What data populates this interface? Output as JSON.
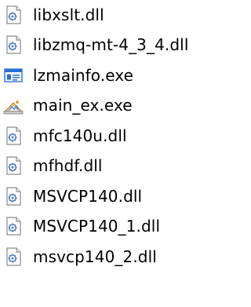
{
  "files": [
    {
      "name": "libxslt.dll",
      "icon": "dll-file-icon"
    },
    {
      "name": "libzmq-mt-4_3_4.dll",
      "icon": "dll-file-icon"
    },
    {
      "name": "lzmainfo.exe",
      "icon": "exe-window-icon"
    },
    {
      "name": "main_ex.exe",
      "icon": "exe-app-icon"
    },
    {
      "name": "mfc140u.dll",
      "icon": "dll-file-icon"
    },
    {
      "name": "mfhdf.dll",
      "icon": "dll-file-icon"
    },
    {
      "name": "MSVCP140.dll",
      "icon": "dll-file-icon"
    },
    {
      "name": "MSVCP140_1.dll",
      "icon": "dll-file-icon"
    },
    {
      "name": "msvcp140_2.dll",
      "icon": "dll-file-icon"
    }
  ],
  "colors": {
    "text": "#000000",
    "icon_outline": "#8c8c8c",
    "gear_blue": "#4a7fc4",
    "window_blue": "#2a6fd6"
  }
}
